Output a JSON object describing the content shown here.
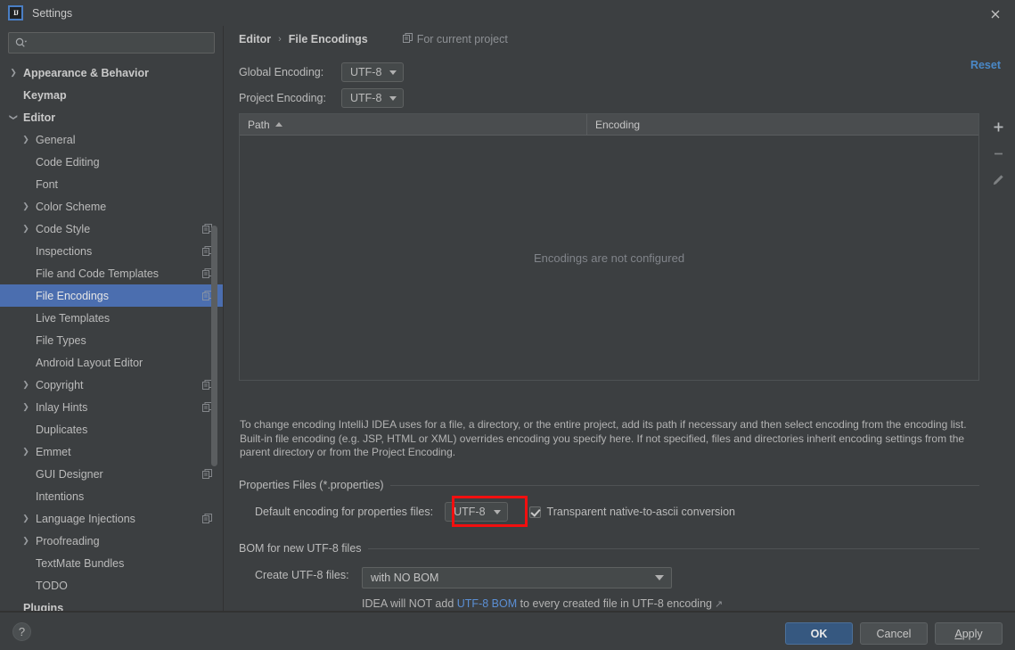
{
  "window": {
    "title": "Settings",
    "logo_text": "IJ",
    "close_icon": "✕"
  },
  "search": {
    "value": "",
    "placeholder": ""
  },
  "sidebar": {
    "items": [
      {
        "label": "Appearance & Behavior",
        "level": 0,
        "arrow": "right",
        "badge": false,
        "selected": false
      },
      {
        "label": "Keymap",
        "level": 0,
        "arrow": "none",
        "badge": false,
        "selected": false
      },
      {
        "label": "Editor",
        "level": 0,
        "arrow": "down",
        "badge": false,
        "selected": false
      },
      {
        "label": "General",
        "level": 1,
        "arrow": "right",
        "badge": false,
        "selected": false
      },
      {
        "label": "Code Editing",
        "level": 1,
        "arrow": "none",
        "badge": false,
        "selected": false
      },
      {
        "label": "Font",
        "level": 1,
        "arrow": "none",
        "badge": false,
        "selected": false
      },
      {
        "label": "Color Scheme",
        "level": 1,
        "arrow": "right",
        "badge": false,
        "selected": false
      },
      {
        "label": "Code Style",
        "level": 1,
        "arrow": "right",
        "badge": true,
        "selected": false
      },
      {
        "label": "Inspections",
        "level": 1,
        "arrow": "none",
        "badge": true,
        "selected": false
      },
      {
        "label": "File and Code Templates",
        "level": 1,
        "arrow": "none",
        "badge": true,
        "selected": false
      },
      {
        "label": "File Encodings",
        "level": 1,
        "arrow": "none",
        "badge": true,
        "selected": true
      },
      {
        "label": "Live Templates",
        "level": 1,
        "arrow": "none",
        "badge": false,
        "selected": false
      },
      {
        "label": "File Types",
        "level": 1,
        "arrow": "none",
        "badge": false,
        "selected": false
      },
      {
        "label": "Android Layout Editor",
        "level": 1,
        "arrow": "none",
        "badge": false,
        "selected": false
      },
      {
        "label": "Copyright",
        "level": 1,
        "arrow": "right",
        "badge": true,
        "selected": false
      },
      {
        "label": "Inlay Hints",
        "level": 1,
        "arrow": "right",
        "badge": true,
        "selected": false
      },
      {
        "label": "Duplicates",
        "level": 1,
        "arrow": "none",
        "badge": false,
        "selected": false
      },
      {
        "label": "Emmet",
        "level": 1,
        "arrow": "right",
        "badge": false,
        "selected": false
      },
      {
        "label": "GUI Designer",
        "level": 1,
        "arrow": "none",
        "badge": true,
        "selected": false
      },
      {
        "label": "Intentions",
        "level": 1,
        "arrow": "none",
        "badge": false,
        "selected": false
      },
      {
        "label": "Language Injections",
        "level": 1,
        "arrow": "right",
        "badge": true,
        "selected": false
      },
      {
        "label": "Proofreading",
        "level": 1,
        "arrow": "right",
        "badge": false,
        "selected": false
      },
      {
        "label": "TextMate Bundles",
        "level": 1,
        "arrow": "none",
        "badge": false,
        "selected": false
      },
      {
        "label": "TODO",
        "level": 1,
        "arrow": "none",
        "badge": false,
        "selected": false
      },
      {
        "label": "Plugins",
        "level": 0,
        "arrow": "none",
        "badge": false,
        "selected": false
      }
    ]
  },
  "main": {
    "breadcrumb": {
      "parent": "Editor",
      "separator": "›",
      "current": "File Encodings"
    },
    "scope_tag": "For current project",
    "reset_label": "Reset",
    "global_encoding": {
      "label": "Global Encoding:",
      "value": "UTF-8"
    },
    "project_encoding": {
      "label": "Project Encoding:",
      "value": "UTF-8"
    },
    "table": {
      "columns": [
        "Path",
        "Encoding"
      ],
      "sort_column": "Path",
      "sort_direction": "asc",
      "rows": [],
      "empty_message": "Encodings are not configured",
      "toolbar": {
        "add": "+",
        "remove": "−",
        "edit": "edit-pencil"
      }
    },
    "help_text": "To change encoding IntelliJ IDEA uses for a file, a directory, or the entire project, add its path if necessary and then select encoding from the encoding list. Built-in file encoding (e.g. JSP, HTML or XML) overrides encoding you specify here. If not specified, files and directories inherit encoding settings from the parent directory or from the Project Encoding.",
    "properties_group": {
      "title": "Properties Files (*.properties)",
      "default_encoding_label": "Default encoding for properties files:",
      "default_encoding_value": "UTF-8",
      "transparent_label": "Transparent native-to-ascii conversion",
      "transparent_checked": true,
      "highlight_color": "#f20f0f"
    },
    "bom_group": {
      "title": "BOM for new UTF-8 files",
      "create_label": "Create UTF-8 files:",
      "create_value": "with NO BOM",
      "note_prefix": "IDEA will NOT add ",
      "note_link": "UTF-8 BOM",
      "note_suffix": " to every created file in UTF-8 encoding",
      "ext_arrow": "↗"
    }
  },
  "footer": {
    "help": "?",
    "ok": "OK",
    "cancel": "Cancel",
    "apply_first": "A",
    "apply_rest": "pply"
  },
  "colors": {
    "background": "#3c3f41",
    "selection": "#4b6eaf",
    "accent_link": "#4a88c7",
    "primary_button": "#365880",
    "highlight": "#f20f0f"
  }
}
